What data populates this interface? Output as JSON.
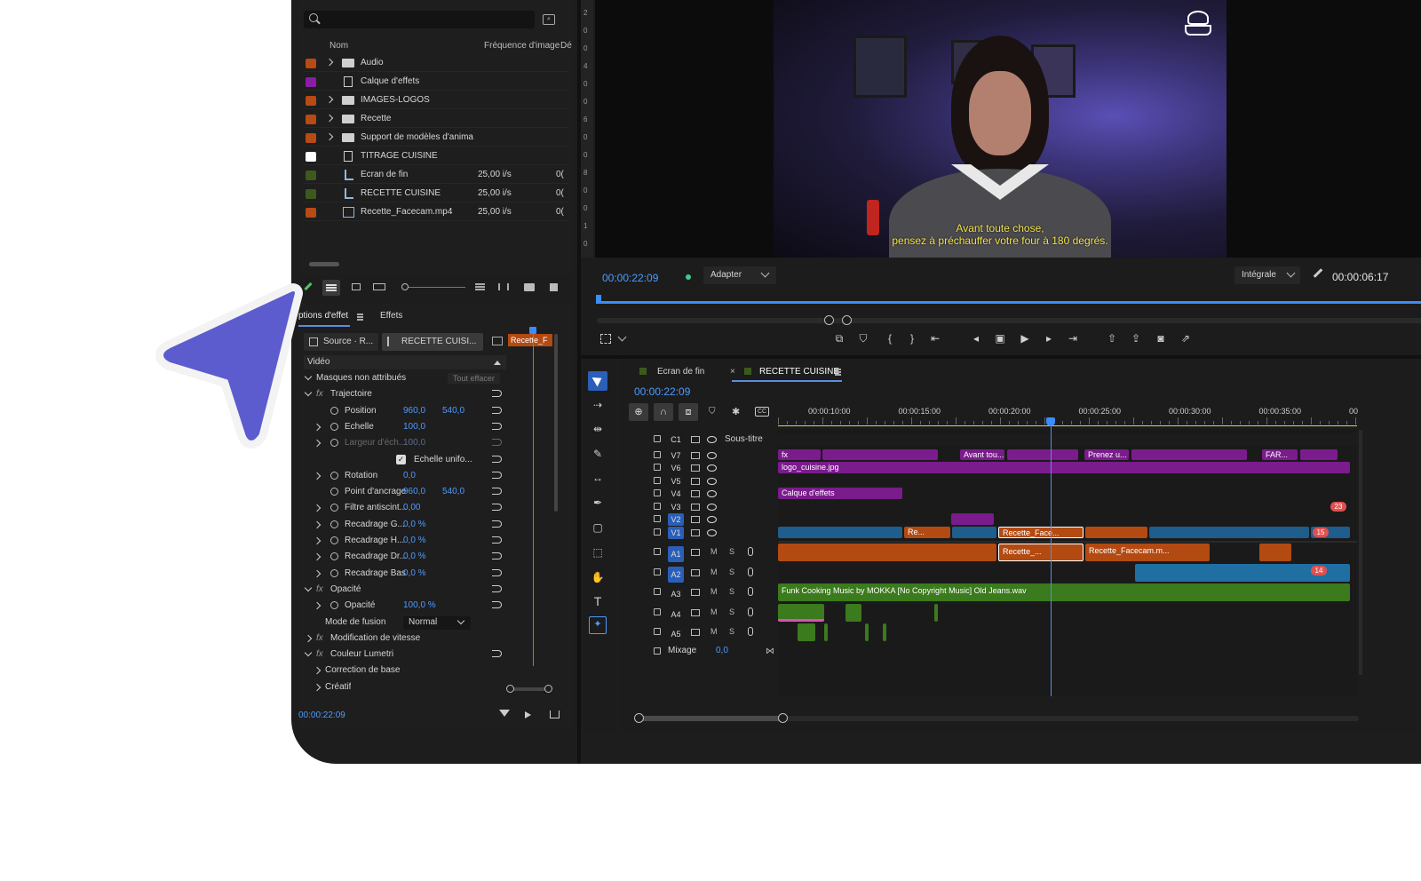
{
  "project": {
    "columns": [
      "Nom",
      "Fréquence d'image",
      "Dé"
    ],
    "items": [
      {
        "color": "#b84a14",
        "expand": true,
        "icon": "folder-icon",
        "name": "Audio",
        "fps": "",
        "extra": ""
      },
      {
        "color": "#8a1ca8",
        "expand": false,
        "icon": "effects-layer-icon",
        "name": "Calque d'effets",
        "fps": "",
        "extra": ""
      },
      {
        "color": "#b84a14",
        "expand": true,
        "icon": "folder-icon",
        "name": "IMAGES-LOGOS",
        "fps": "",
        "extra": ""
      },
      {
        "color": "#b84a14",
        "expand": true,
        "icon": "folder-icon",
        "name": "Recette",
        "fps": "",
        "extra": ""
      },
      {
        "color": "#b84a14",
        "expand": true,
        "icon": "folder-icon",
        "name": "Support de modèles d'anima",
        "fps": "",
        "extra": ""
      },
      {
        "color": "#ffffff",
        "expand": false,
        "icon": "title-icon",
        "name": "TITRAGE CUISINE",
        "fps": "",
        "extra": ""
      },
      {
        "color": "#3c5a1c",
        "expand": false,
        "icon": "sequence-icon",
        "name": "Ecran de fin",
        "fps": "25,00 i/s",
        "extra": "0("
      },
      {
        "color": "#3c5a1c",
        "expand": false,
        "icon": "sequence-icon",
        "name": "RECETTE CUISINE",
        "fps": "25,00 i/s",
        "extra": "0("
      },
      {
        "color": "#b84a14",
        "expand": false,
        "icon": "clip-icon",
        "name": "Recette_Facecam.mp4",
        "fps": "25,00 i/s",
        "extra": "0("
      }
    ]
  },
  "effects_panel": {
    "tabs": [
      "ptions d'effet",
      "Effets"
    ],
    "source_label": "Source · R...",
    "sequence_label": "RECETTE CUISI...",
    "clip_label": "Recette_F",
    "section": "Vidéo",
    "clear_all": "Tout effacer",
    "rows": [
      {
        "indent": 0,
        "arrow": "down",
        "fx": false,
        "stopwatch": false,
        "name": "Masques non attribués",
        "v1": "",
        "v2": "",
        "reset": false,
        "check": false
      },
      {
        "indent": 0,
        "arrow": "down",
        "fx": true,
        "stopwatch": false,
        "name": "Trajectoire",
        "v1": "",
        "v2": "",
        "reset": true,
        "check": false
      },
      {
        "indent": 1,
        "arrow": "",
        "fx": false,
        "stopwatch": true,
        "name": "Position",
        "v1": "960,0",
        "v2": "540,0",
        "reset": true,
        "check": false
      },
      {
        "indent": 1,
        "arrow": "right",
        "fx": false,
        "stopwatch": true,
        "name": "Echelle",
        "v1": "100,0",
        "v2": "",
        "reset": true,
        "check": false
      },
      {
        "indent": 1,
        "arrow": "right",
        "fx": false,
        "stopwatch": true,
        "name": "Largeur d'éch...",
        "v1": "100,0",
        "v2": "",
        "reset": true,
        "check": false,
        "dim": true
      },
      {
        "indent": 2,
        "arrow": "",
        "fx": false,
        "stopwatch": false,
        "name": "Echelle unifo...",
        "v1": "",
        "v2": "",
        "reset": true,
        "check": true
      },
      {
        "indent": 1,
        "arrow": "right",
        "fx": false,
        "stopwatch": true,
        "name": "Rotation",
        "v1": "0,0",
        "v2": "",
        "reset": true,
        "check": false
      },
      {
        "indent": 1,
        "arrow": "",
        "fx": false,
        "stopwatch": true,
        "name": "Point d'ancrage",
        "v1": "960,0",
        "v2": "540,0",
        "reset": true,
        "check": false
      },
      {
        "indent": 1,
        "arrow": "right",
        "fx": false,
        "stopwatch": true,
        "name": "Filtre antiscint...",
        "v1": "0,00",
        "v2": "",
        "reset": true,
        "check": false
      },
      {
        "indent": 1,
        "arrow": "right",
        "fx": false,
        "stopwatch": true,
        "name": "Recadrage G...",
        "v1": "0,0 %",
        "v2": "",
        "reset": true,
        "check": false
      },
      {
        "indent": 1,
        "arrow": "right",
        "fx": false,
        "stopwatch": true,
        "name": "Recadrage H...",
        "v1": "0,0 %",
        "v2": "",
        "reset": true,
        "check": false
      },
      {
        "indent": 1,
        "arrow": "right",
        "fx": false,
        "stopwatch": true,
        "name": "Recadrage Dr...",
        "v1": "0,0 %",
        "v2": "",
        "reset": true,
        "check": false
      },
      {
        "indent": 1,
        "arrow": "right",
        "fx": false,
        "stopwatch": true,
        "name": "Recadrage Bas",
        "v1": "0,0 %",
        "v2": "",
        "reset": true,
        "check": false
      },
      {
        "indent": 0,
        "arrow": "down",
        "fx": true,
        "stopwatch": false,
        "name": "Opacité",
        "v1": "",
        "v2": "",
        "reset": true,
        "check": false
      },
      {
        "indent": 1,
        "arrow": "right",
        "fx": false,
        "stopwatch": true,
        "name": "Opacité",
        "v1": "100,0 %",
        "v2": "",
        "reset": true,
        "check": false
      },
      {
        "indent": 1,
        "arrow": "",
        "fx": false,
        "stopwatch": false,
        "name": "Mode de fusion",
        "v1": "",
        "v2": "",
        "reset": false,
        "check": false,
        "select": "Normal"
      },
      {
        "indent": 0,
        "arrow": "right",
        "fx": true,
        "stopwatch": false,
        "name": "Modification de vitesse",
        "v1": "",
        "v2": "",
        "reset": false,
        "check": false
      },
      {
        "indent": 0,
        "arrow": "down",
        "fx": true,
        "stopwatch": false,
        "name": "Couleur Lumetri",
        "v1": "",
        "v2": "",
        "reset": true,
        "check": false
      },
      {
        "indent": 1,
        "arrow": "right",
        "fx": false,
        "stopwatch": false,
        "name": "Correction de base",
        "v1": "",
        "v2": "",
        "reset": false,
        "check": false
      },
      {
        "indent": 1,
        "arrow": "right",
        "fx": false,
        "stopwatch": false,
        "name": "Créatif",
        "v1": "",
        "v2": "",
        "reset": false,
        "check": false
      }
    ],
    "timecode": "00:00:22:09"
  },
  "program": {
    "ruler_labels": [
      "2",
      "0",
      "0",
      "4",
      "0",
      "0",
      "6",
      "0",
      "0",
      "8",
      "0",
      "0",
      "1",
      "0"
    ],
    "subtitle_line1": "Avant toute chose,",
    "subtitle_line2": "pensez à préchauffer votre four à 180 degrés.",
    "timecode": "00:00:22:09",
    "fit": "Adapter",
    "quality": "Intégrale",
    "duration": "00:00:06:17"
  },
  "timeline": {
    "tabs": [
      "Ecran de fin",
      "RECETTE CUISINE"
    ],
    "timecode": "00:00:22:09",
    "ruler": [
      "00:00:10:00",
      "00:00:15:00",
      "00:00:20:00",
      "00:00:25:00",
      "00:00:30:00",
      "00:00:35:00",
      "00"
    ],
    "tracks": [
      {
        "id": "C1",
        "label": "Sous-titre",
        "kind": "video"
      },
      {
        "id": "V7",
        "label": "",
        "kind": "video"
      },
      {
        "id": "V6",
        "label": "",
        "kind": "video"
      },
      {
        "id": "V5",
        "label": "",
        "kind": "video"
      },
      {
        "id": "V4",
        "label": "",
        "kind": "video"
      },
      {
        "id": "V3",
        "label": "",
        "kind": "video"
      },
      {
        "id": "V2",
        "label": "",
        "kind": "video"
      },
      {
        "id": "V1",
        "label": "",
        "kind": "video"
      },
      {
        "id": "A1",
        "label": "",
        "kind": "audio"
      },
      {
        "id": "A2",
        "label": "",
        "kind": "audio"
      },
      {
        "id": "A3",
        "label": "",
        "kind": "audio"
      },
      {
        "id": "A4",
        "label": "",
        "kind": "audio"
      },
      {
        "id": "A5",
        "label": "",
        "kind": "audio"
      }
    ],
    "mix_label": "Mixage",
    "mix_value": "0,0",
    "clips": {
      "v7_texts": [
        "Avant tou...",
        "Prenez u...",
        "FAR..."
      ],
      "v6": "logo_cuisine.jpg",
      "v4": "Calque d'effets",
      "v1_a": "Re...",
      "v1_b": "Recette_Face...",
      "a1_a": "Recette_...",
      "a1_b": "Recette_Facecam.m...",
      "a3": "Funk Cooking Music by MOKKA [No Copyright Music]   Old Jeans.wav",
      "badge1": "23",
      "badge2": "15",
      "badge3": "14"
    },
    "mute": "M",
    "solo": "S",
    "fx": "fx"
  }
}
